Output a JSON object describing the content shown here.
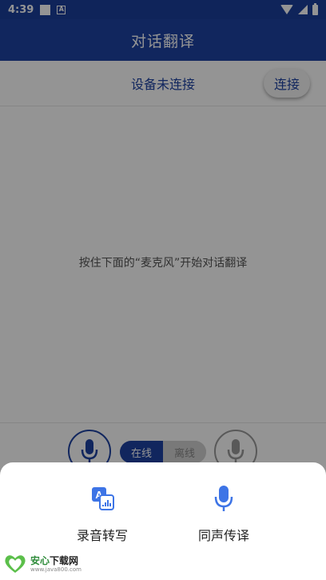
{
  "statusbar": {
    "time": "4:39",
    "a_icon": "A"
  },
  "appbar": {
    "title": "对话翻译"
  },
  "device": {
    "status": "设备未连接",
    "connect_label": "连接"
  },
  "content": {
    "hint": "按住下面的“麦克风”开始对话翻译"
  },
  "mode_toggle": {
    "online": "在线",
    "offline": "离线"
  },
  "sheet": {
    "options": [
      {
        "label": "录音转写",
        "icon": "translate-doc-icon"
      },
      {
        "label": "同声传译",
        "icon": "microphone-icon"
      }
    ]
  },
  "watermark": {
    "brand": "安心",
    "brand_suffix": "下载网",
    "url": "www.java800.com"
  },
  "colors": {
    "primary": "#1e43a3",
    "accent": "#3d74e6",
    "overlay": "rgba(0,0,0,0.42)"
  }
}
